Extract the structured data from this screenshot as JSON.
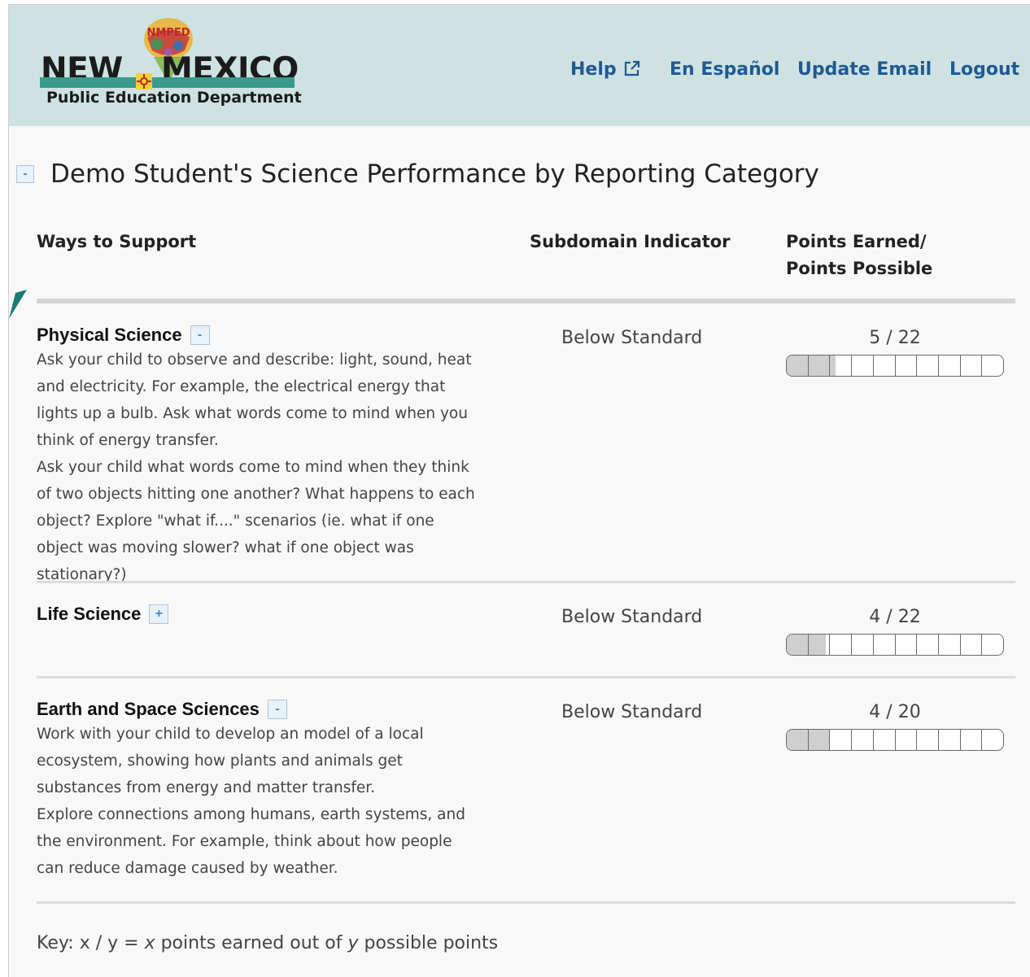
{
  "header": {
    "logo": {
      "emblem_text": "NMPED",
      "line1_left": "NEW",
      "line1_right": "MEXICO",
      "subtitle": "Public Education Department"
    },
    "nav": [
      {
        "label": "Help",
        "icon": "external-link-icon"
      },
      {
        "label": "En Español"
      },
      {
        "label": "Update Email"
      },
      {
        "label": "Logout"
      }
    ],
    "colors": {
      "header_bg": "#cfe2e2",
      "nav_link": "#1f5a93",
      "logo_bar": "#3a9a8e"
    }
  },
  "section": {
    "toggle": "-",
    "title": "Demo Student's Science Performance by Reporting Category"
  },
  "columns": {
    "ways": "Ways to Support",
    "indicator": "Subdomain Indicator",
    "points_line1": "Points Earned/",
    "points_line2": "Points Possible"
  },
  "categories": [
    {
      "name": "Physical Science",
      "toggle": "-",
      "expanded": true,
      "description": [
        "Ask your child to observe and describe: light, sound, heat and electricity. For example, the electrical energy that lights up a bulb. Ask what words come to mind when you think of energy transfer.",
        "Ask your child what words come to mind when they think of two objects hitting one another? What happens to each object? Explore \"what if....\" scenarios (ie. what if one object was moving slower? what if one object was stationary?)"
      ],
      "indicator": "Below Standard",
      "score_text": "5 / 22",
      "earned": 5,
      "possible": 22
    },
    {
      "name": "Life Science",
      "toggle": "+",
      "expanded": false,
      "description": [],
      "indicator": "Below Standard",
      "score_text": "4 / 22",
      "earned": 4,
      "possible": 22
    },
    {
      "name": "Earth and Space Sciences",
      "toggle": "-",
      "expanded": true,
      "description": [
        "Work with your child to develop an model of a local ecosystem, showing how plants and animals get substances from energy and matter transfer.",
        "Explore connections among humans, earth systems, and the environment. For example, think about how people can reduce damage caused by weather."
      ],
      "indicator": "Below Standard",
      "score_text": "4 / 20",
      "earned": 4,
      "possible": 20
    }
  ],
  "key": {
    "prefix": "Key: x / y = ",
    "x": "x",
    "middle": " points earned out of ",
    "y": "y",
    "suffix": " possible points"
  },
  "bar_segments": 10,
  "bar_fill_color": "#cfcfcf"
}
